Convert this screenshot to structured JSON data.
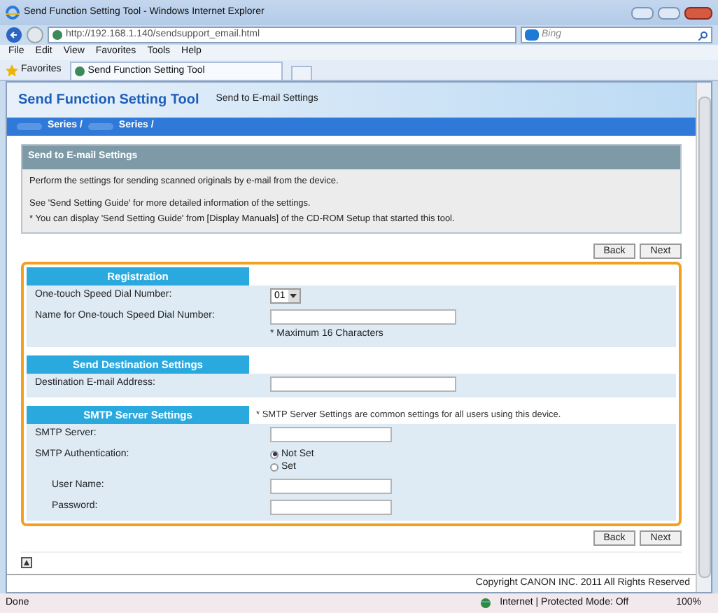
{
  "window": {
    "title": "Send Function Setting Tool - Windows Internet Explorer"
  },
  "address": {
    "value": "http://192.168.1.140/sendsupport_email.html"
  },
  "search": {
    "placeholder": "Bing"
  },
  "menu": [
    "File",
    "Edit",
    "View",
    "Favorites",
    "Tools",
    "Help"
  ],
  "favorites": {
    "label": "Favorites",
    "tab": "Send Function Setting Tool"
  },
  "header": {
    "title": "Send Function Setting Tool",
    "subtitle": "Send to E-mail Settings"
  },
  "breadcrumb": [
    "Series /",
    "Series /"
  ],
  "info": {
    "title": "Send to E-mail Settings",
    "lines": [
      "Perform the settings for sending scanned originals by e-mail from the device.",
      "See 'Send Setting Guide' for more detailed information of the settings.",
      "* You can display 'Send Setting Guide' from [Display Manuals] of the CD-ROM Setup that started this tool."
    ]
  },
  "top_buttons": [
    "Back",
    "Next"
  ],
  "sections": [
    {
      "title": "Registration",
      "rows": [
        {
          "kind": "select",
          "label": "One-touch Speed Dial Number:",
          "value": "01"
        },
        {
          "kind": "text",
          "label": "Name for One-touch Speed Dial Number:",
          "hint": "* Maximum 16 Characters"
        }
      ]
    },
    {
      "title": "Send Destination Settings",
      "rows": [
        {
          "kind": "text",
          "label": "Destination E-mail Address:"
        }
      ]
    },
    {
      "title": "SMTP Server Settings",
      "note": "* SMTP Server Settings are common settings for all users using this device.",
      "rows": [
        {
          "kind": "short",
          "label": "SMTP Server:"
        },
        {
          "kind": "radio",
          "label": "SMTP Authentication:",
          "options": [
            {
              "label": "Not Set",
              "selected": true
            },
            {
              "label": "Set",
              "selected": false
            }
          ]
        },
        {
          "kind": "short",
          "label": "User Name:",
          "indent": true
        },
        {
          "kind": "short",
          "label": "Password:",
          "indent": true
        }
      ]
    }
  ],
  "bottom_buttons": [
    "Back",
    "Next"
  ],
  "footer": "Copyright CANON INC. 2011 All Rights Reserved",
  "status_bar": {
    "status": "Done",
    "zone": "Internet | Protected Mode: Off",
    "zoom": "100%"
  }
}
